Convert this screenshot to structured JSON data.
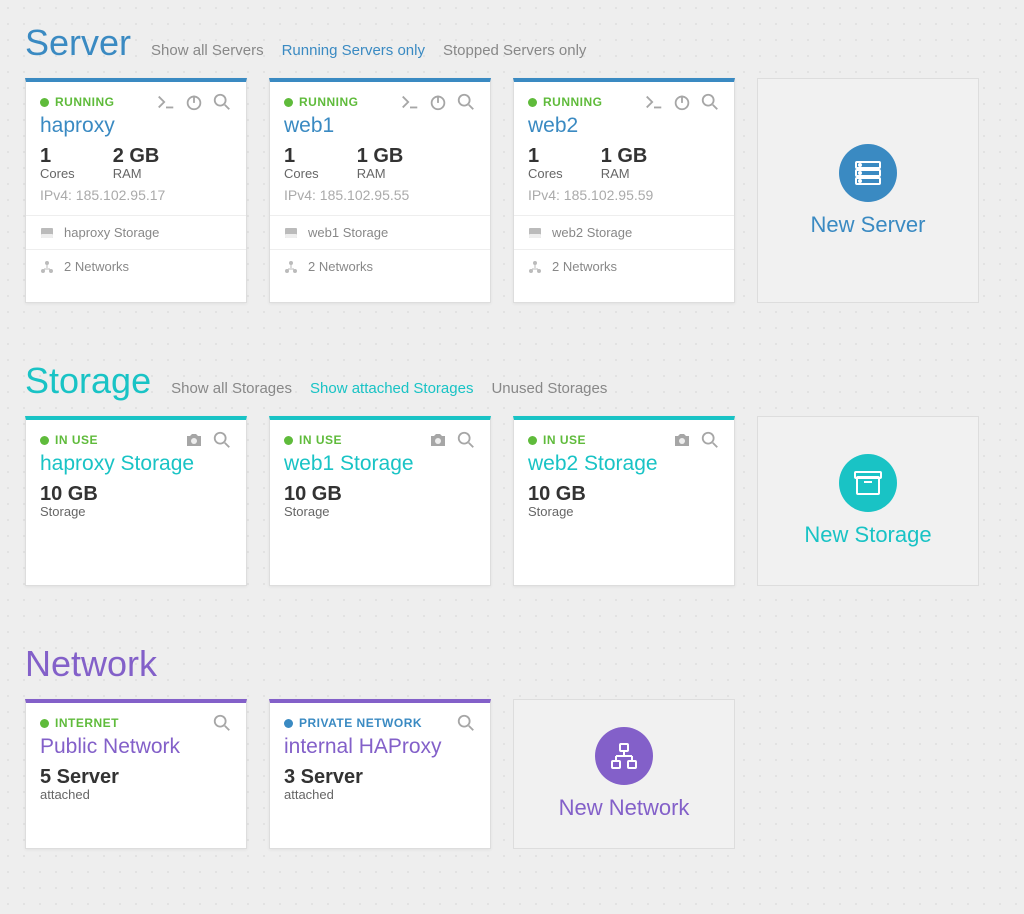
{
  "server": {
    "title": "Server",
    "filters": [
      "Show all Servers",
      "Running Servers only",
      "Stopped Servers only"
    ],
    "activeFilter": 1,
    "newLabel": "New Server",
    "items": [
      {
        "status": "RUNNING",
        "name": "haproxy",
        "coresVal": "1",
        "coresLbl": "Cores",
        "ramVal": "2 GB",
        "ramLbl": "RAM",
        "ip": "IPv4: 185.102.95.17",
        "storage": "haproxy Storage",
        "networks": "2 Networks"
      },
      {
        "status": "RUNNING",
        "name": "web1",
        "coresVal": "1",
        "coresLbl": "Cores",
        "ramVal": "1 GB",
        "ramLbl": "RAM",
        "ip": "IPv4: 185.102.95.55",
        "storage": "web1 Storage",
        "networks": "2 Networks"
      },
      {
        "status": "RUNNING",
        "name": "web2",
        "coresVal": "1",
        "coresLbl": "Cores",
        "ramVal": "1 GB",
        "ramLbl": "RAM",
        "ip": "IPv4: 185.102.95.59",
        "storage": "web2 Storage",
        "networks": "2 Networks"
      }
    ]
  },
  "storage": {
    "title": "Storage",
    "filters": [
      "Show all Storages",
      "Show attached Storages",
      "Unused Storages"
    ],
    "activeFilter": 1,
    "newLabel": "New Storage",
    "items": [
      {
        "status": "IN USE",
        "name": "haproxy Storage",
        "sizeVal": "10 GB",
        "sizeLbl": "Storage"
      },
      {
        "status": "IN USE",
        "name": "web1 Storage",
        "sizeVal": "10 GB",
        "sizeLbl": "Storage"
      },
      {
        "status": "IN USE",
        "name": "web2 Storage",
        "sizeVal": "10 GB",
        "sizeLbl": "Storage"
      }
    ]
  },
  "network": {
    "title": "Network",
    "newLabel": "New Network",
    "items": [
      {
        "status": "INTERNET",
        "statusColor": "green",
        "name": "Public Network",
        "countVal": "5 Server",
        "countLbl": "attached"
      },
      {
        "status": "PRIVATE NETWORK",
        "statusColor": "blue",
        "name": "internal HAProxy",
        "countVal": "3 Server",
        "countLbl": "attached"
      }
    ]
  }
}
